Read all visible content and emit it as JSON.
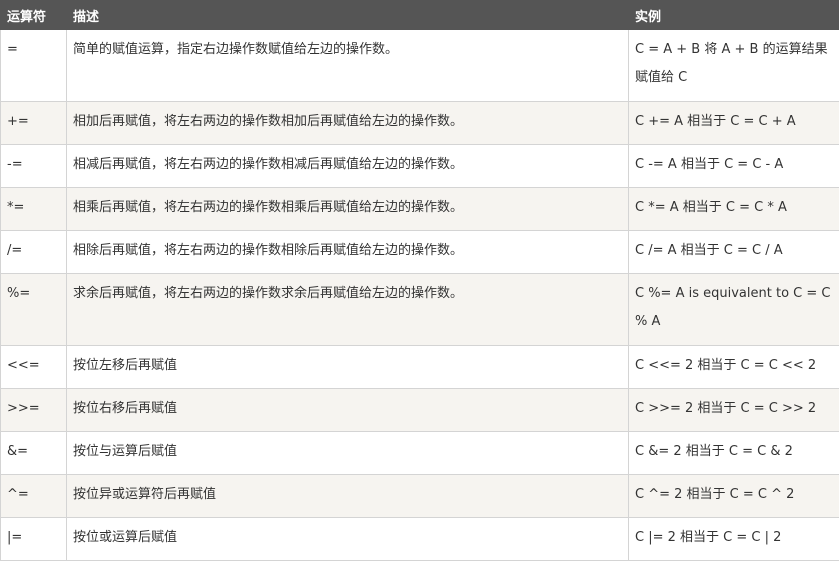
{
  "table": {
    "headers": [
      "运算符",
      "描述",
      "实例"
    ],
    "rows": [
      {
        "op": "=",
        "desc": "简单的赋值运算，指定右边操作数赋值给左边的操作数。",
        "example": "C = A + B 将 A + B 的运算结果赋值给 C"
      },
      {
        "op": "+=",
        "desc": "相加后再赋值，将左右两边的操作数相加后再赋值给左边的操作数。",
        "example": "C += A 相当于 C = C + A"
      },
      {
        "op": "-=",
        "desc": "相减后再赋值，将左右两边的操作数相减后再赋值给左边的操作数。",
        "example": "C -= A 相当于 C = C - A"
      },
      {
        "op": "*=",
        "desc": "相乘后再赋值，将左右两边的操作数相乘后再赋值给左边的操作数。",
        "example": "C *= A 相当于 C = C * A"
      },
      {
        "op": "/=",
        "desc": "相除后再赋值，将左右两边的操作数相除后再赋值给左边的操作数。",
        "example": "C /= A 相当于 C = C / A"
      },
      {
        "op": "%=",
        "desc": "求余后再赋值，将左右两边的操作数求余后再赋值给左边的操作数。",
        "example": "C %= A is equivalent to C = C % A"
      },
      {
        "op": "<<=",
        "desc": "按位左移后再赋值",
        "example": "C <<= 2 相当于 C = C << 2"
      },
      {
        "op": ">>=",
        "desc": "按位右移后再赋值",
        "example": "C >>= 2 相当于 C = C >> 2"
      },
      {
        "op": "&=",
        "desc": "按位与运算后赋值",
        "example": "C &= 2 相当于 C = C & 2"
      },
      {
        "op": "^=",
        "desc": "按位异或运算符后再赋值",
        "example": "C ^= 2 相当于 C = C ^ 2"
      },
      {
        "op": "|=",
        "desc": "按位或运算后赋值",
        "example": "C |= 2 相当于 C = C | 2"
      }
    ]
  }
}
